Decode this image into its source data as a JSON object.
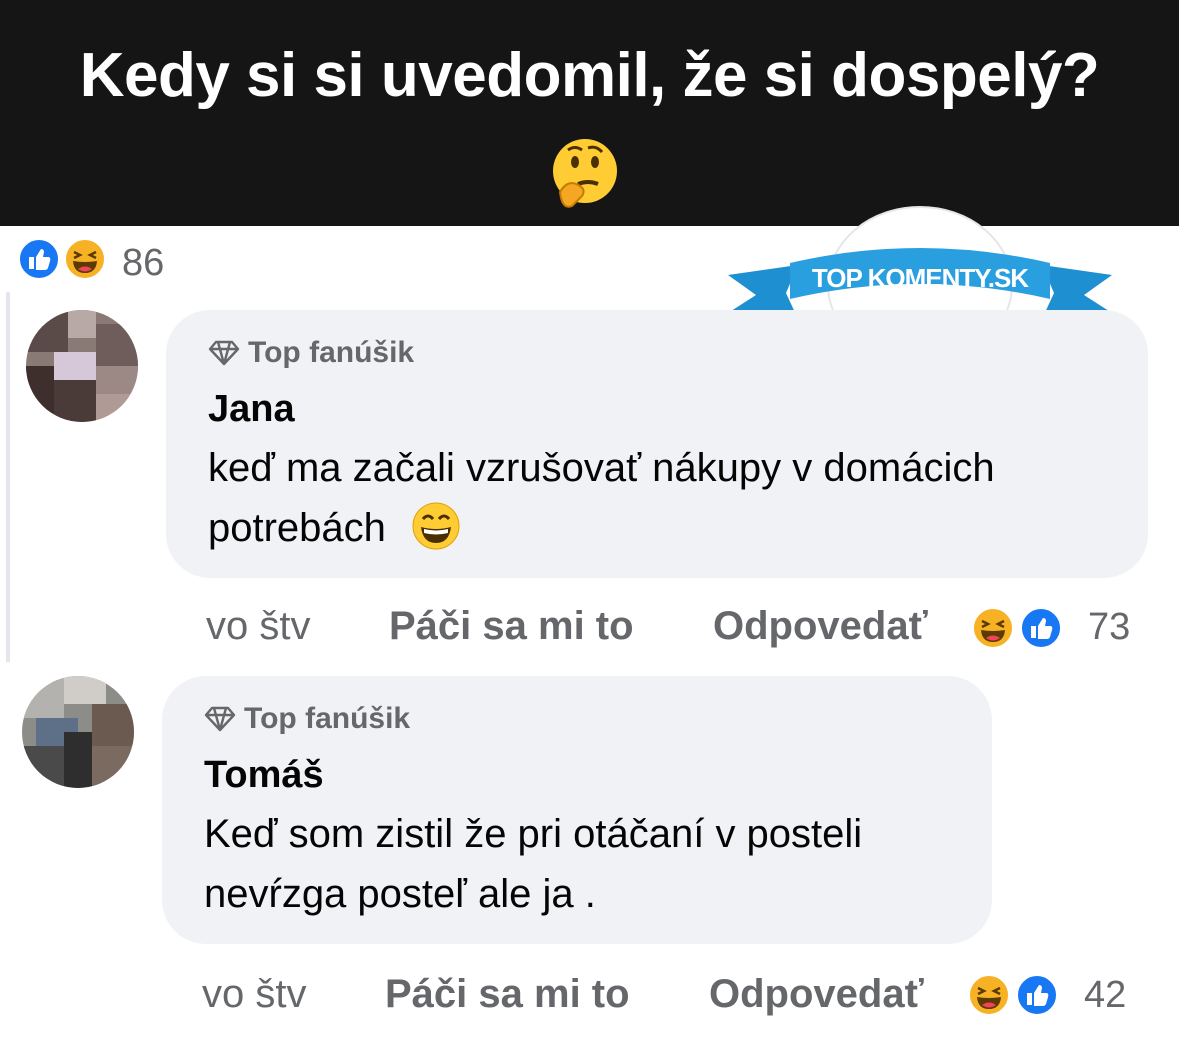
{
  "header": {
    "title": "Kedy si si uvedomil, že si dospelý?",
    "emoji_icon": "thinking-face-icon"
  },
  "post_reactions": {
    "icons": [
      "like-icon",
      "haha-icon"
    ],
    "count": "86"
  },
  "watermark": {
    "text": "TOP KOMENTY.SK"
  },
  "comments": [
    {
      "badge": "Top fanúšik",
      "author": "Jana",
      "text_lines": [
        "keď ma začali vzrušovať nákupy v domácich",
        "potrebách"
      ],
      "trailing_emoji": "grinning-squinting-face-icon",
      "time": "vo štv",
      "like_label": "Páči sa mi to",
      "reply_label": "Odpovedať",
      "reaction_icons": [
        "haha-icon",
        "like-icon"
      ],
      "reaction_count": "73"
    },
    {
      "badge": "Top fanúšik",
      "author": "Tomáš",
      "text_lines": [
        "Keď som zistil že pri otáčaní v posteli",
        "nevŕzga posteľ ale ja ."
      ],
      "time": "vo štv",
      "like_label": "Páči sa mi to",
      "reply_label": "Odpovedať",
      "reaction_icons": [
        "haha-icon",
        "like-icon"
      ],
      "reaction_count": "42"
    }
  ],
  "colors": {
    "header_bg": "#151515",
    "bubble_bg": "#f0f2f5",
    "secondary_text": "#65676b",
    "like_blue": "#1877f2",
    "ribbon_blue": "#1e8fd0"
  }
}
